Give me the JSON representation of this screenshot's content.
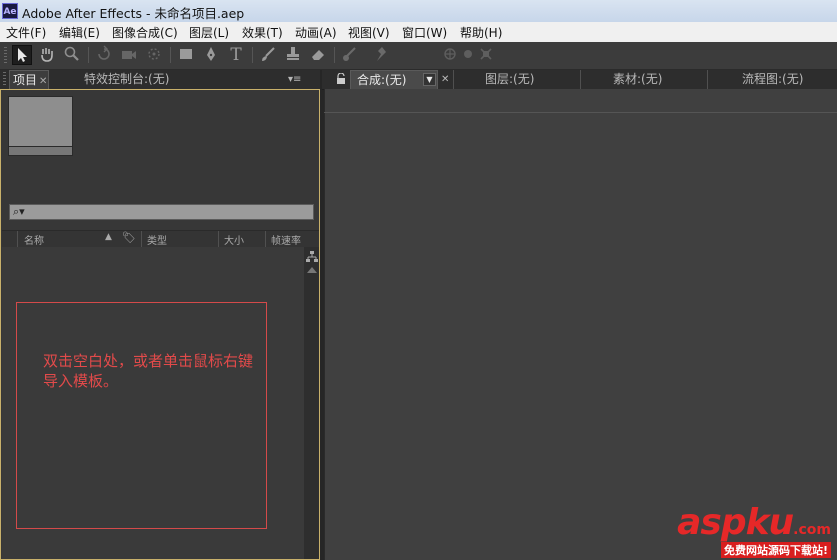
{
  "titlebar": {
    "logo": "Ae",
    "title": "Adobe After Effects - 未命名项目.aep"
  },
  "menu": [
    "文件(F)",
    "编辑(E)",
    "图像合成(C)",
    "图层(L)",
    "效果(T)",
    "动画(A)",
    "视图(V)",
    "窗口(W)",
    "帮助(H)"
  ],
  "toolbar": {
    "icons": [
      "selection-arrow",
      "hand",
      "zoom",
      "rotate",
      "camera",
      "pan-behind",
      "rectangle",
      "pen",
      "type",
      "brush",
      "clone-stamp",
      "eraser",
      "roto-brush",
      "puppet-pin",
      "axis-tools"
    ]
  },
  "project_panel": {
    "tab_project": "项目",
    "tab_effects": "特效控制台:(无)",
    "search_placeholder": "⌕▾",
    "columns": {
      "name": "名称",
      "type": "类型",
      "size": "大小",
      "fps": "帧速率"
    },
    "hint": "双击空白处，或者单击鼠标右键导入模板。",
    "annotation_color": "#e24a4a"
  },
  "viewer": {
    "tab_comp": "合成:(无)",
    "tab_layer": "图层:(无)",
    "tab_footage": "素材:(无)",
    "tab_flowchart": "流程图:(无)"
  },
  "watermark": {
    "brand": "aspku",
    "suffix": ".com",
    "tagline": "免费网站源码下载站!"
  }
}
